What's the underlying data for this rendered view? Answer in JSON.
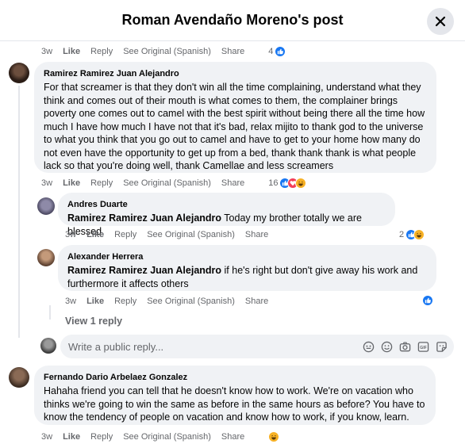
{
  "header": {
    "title": "Roman Avendaño Moreno's post"
  },
  "actions_labels": {
    "like": "Like",
    "reply": "Reply",
    "see_original": "See Original (Spanish)",
    "share": "Share"
  },
  "top_row": {
    "time": "3w",
    "count": "4"
  },
  "comments": [
    {
      "author": "Ramirez Ramirez Juan Alejandro",
      "text": "For that screamer is that they don't win all the time complaining, understand what they think and comes out of their mouth is what comes to them, the complainer brings poverty one comes out to camel with the best spirit without being there all the time how much I have how much I have not that it's bad, relax mijito to thank god to the universe to what you think that you go out to camel and have to get to your home how many do not even have the opportunity to get up from a bed, thank thank thank is what people lack so that you're doing well, thank Camellae and less screamers",
      "time": "3w",
      "count": "16"
    },
    {
      "author": "Andres Duarte",
      "mention": "Ramirez Ramirez Juan Alejandro",
      "text": "Today my brother totally we are blessed",
      "time": "3w",
      "count": "2"
    },
    {
      "author": "Alexander Herrera",
      "mention": "Ramirez Ramirez Juan Alejandro",
      "text": "if he's right but don't give away his work and furthermore it affects others",
      "time": "3w",
      "count": ""
    },
    {
      "author": "Fernando Dario Arbelaez Gonzalez",
      "text": "Hahaha friend you can tell that he doesn't know how to work. We're on vacation who thinks we're going to win the same as before in the same hours as before? You have to know the tendency of people on vacation and know how to work, if you know, learn.",
      "time": "3w",
      "count": ""
    }
  ],
  "view_replies": "View 1 reply",
  "reply_box": {
    "placeholder": "Write a public reply..."
  },
  "colors": {
    "like_blue": "#1877f2",
    "love_red": "#f33e58",
    "haha_yellow": "#f7b125",
    "text_secondary": "#65676b",
    "bubble": "#f0f2f5"
  }
}
